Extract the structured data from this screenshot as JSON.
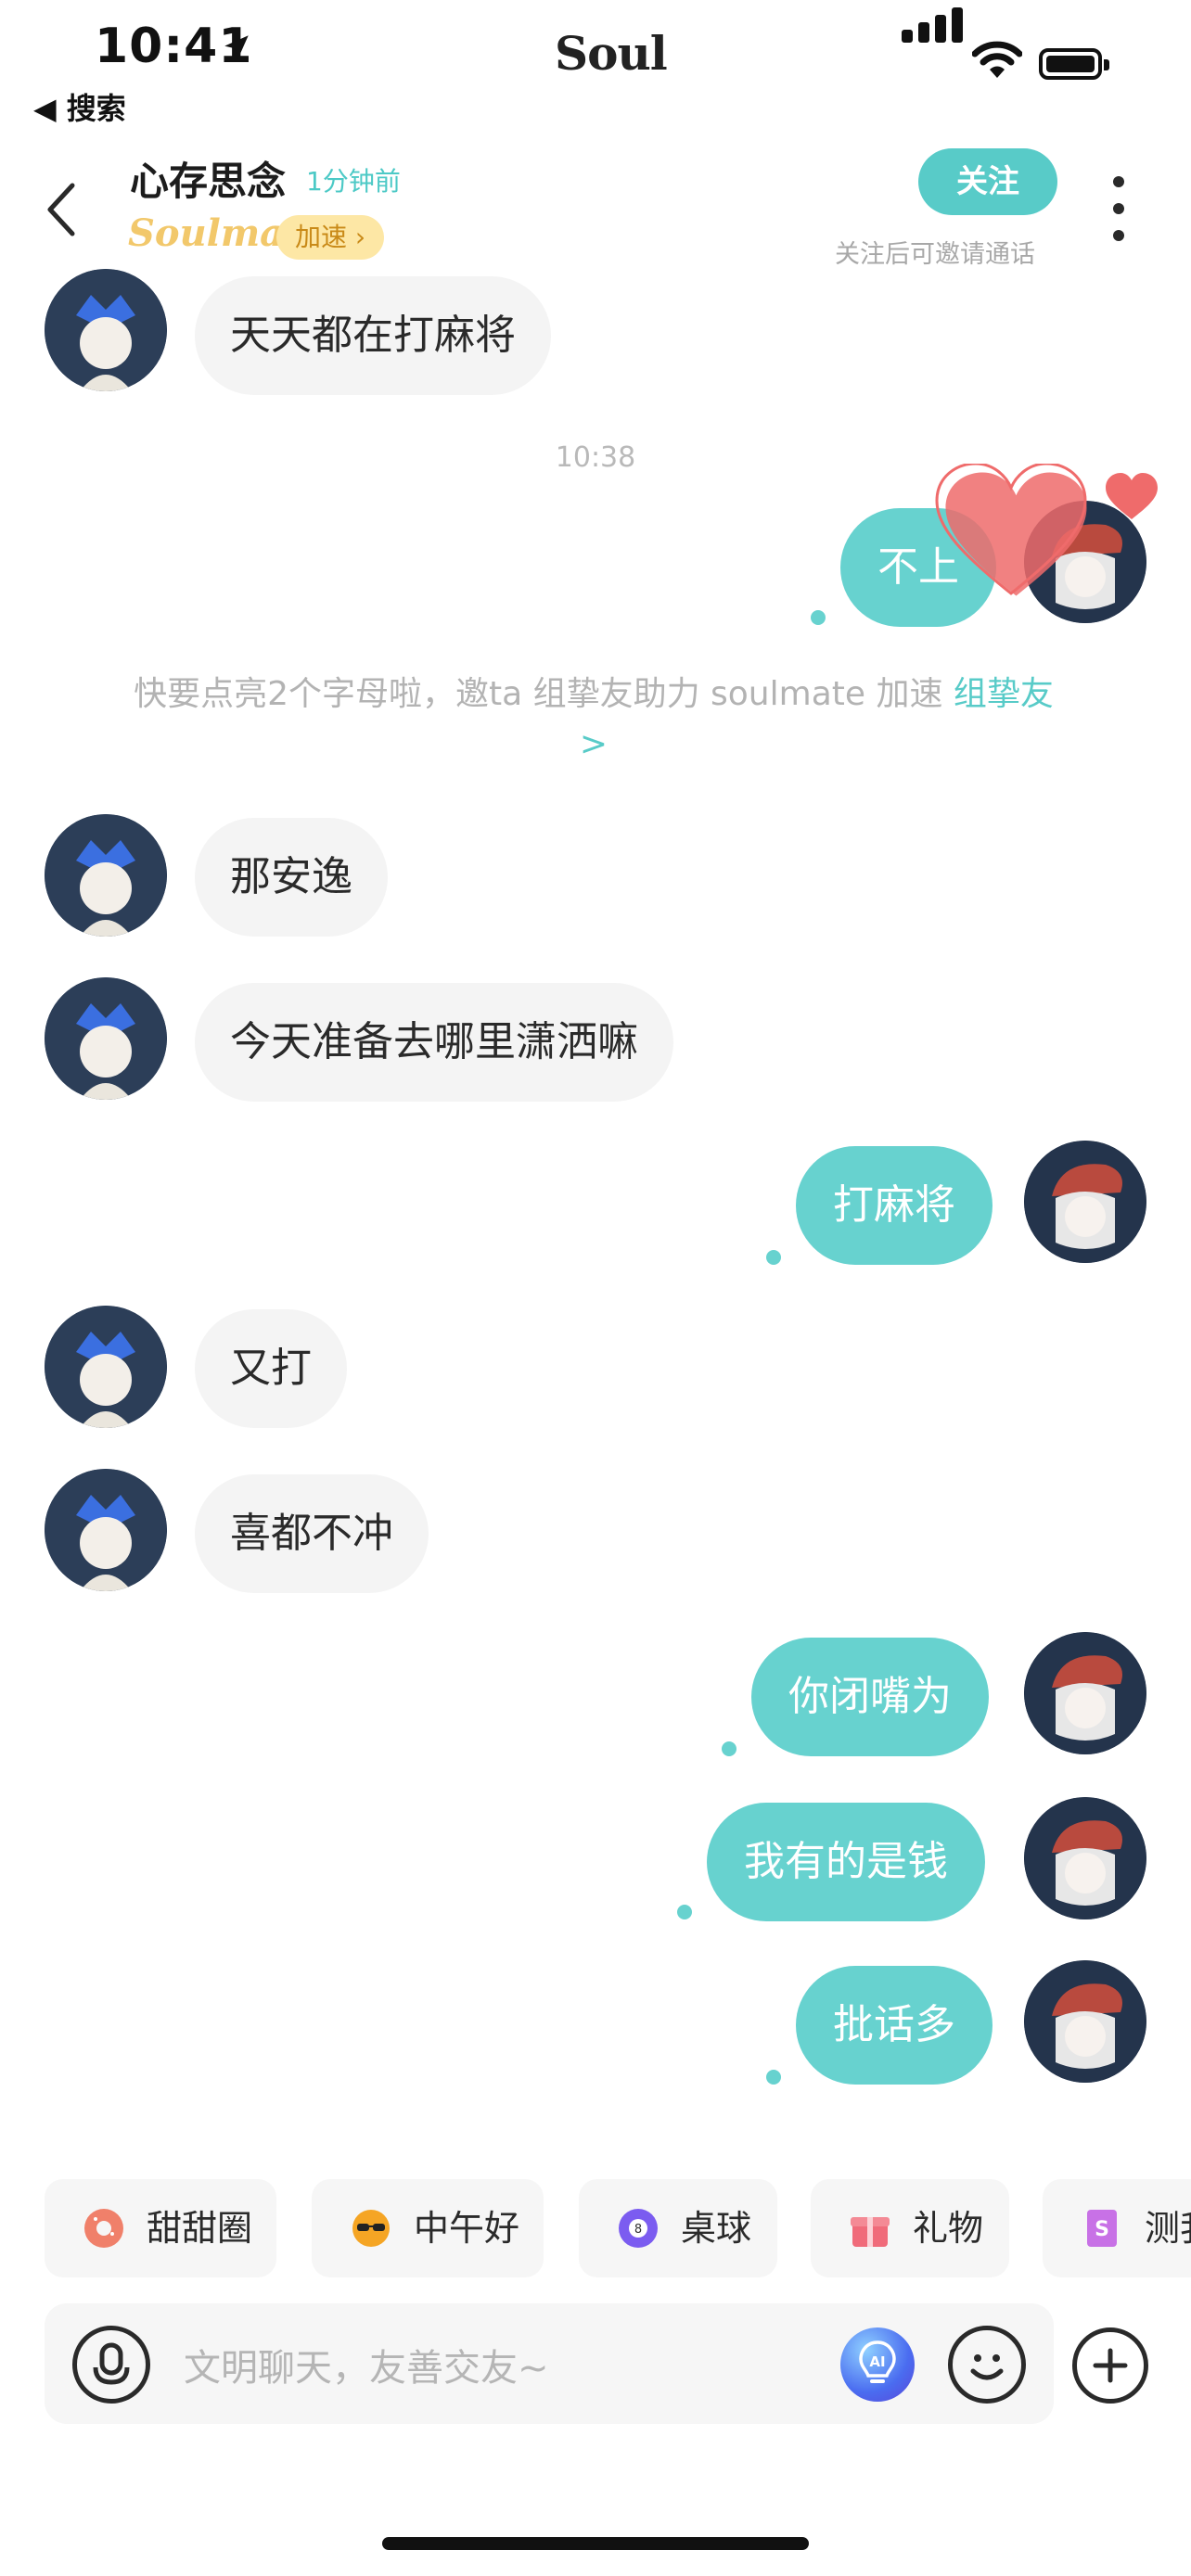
{
  "status_bar": {
    "time": "10:41",
    "back_app": "◀ 搜索",
    "app_logo": "Soul"
  },
  "header": {
    "name": "心存思念",
    "last_active": "1分钟前",
    "soulmate_label": "Soulmate",
    "accelerate": "加速 ›",
    "follow": "关注",
    "follow_hint": "关注后可邀请通话"
  },
  "messages": [
    {
      "side": "in",
      "text": "天天都在打麻将"
    },
    {
      "type": "time",
      "text": "10:38"
    },
    {
      "side": "out",
      "text": "不上"
    },
    {
      "type": "system",
      "text": "快要点亮2个字母啦，邀ta 组挚友助力 soulmate 加速 ",
      "link": "组挚友>"
    },
    {
      "side": "in",
      "text": "那安逸"
    },
    {
      "side": "in",
      "text": "今天准备去哪里潇洒嘛"
    },
    {
      "side": "out",
      "text": "打麻将"
    },
    {
      "side": "in",
      "text": "又打"
    },
    {
      "side": "in",
      "text": "喜都不冲"
    },
    {
      "side": "out",
      "text": "你闭嘴为"
    },
    {
      "side": "out",
      "text": "我有的是钱"
    },
    {
      "side": "out",
      "text": "批话多"
    }
  ],
  "quick_actions": [
    {
      "label": "甜甜圈",
      "icon": "donut-icon"
    },
    {
      "label": "中午好",
      "icon": "sun-sunglasses-icon"
    },
    {
      "label": "桌球",
      "icon": "billiard-ball-icon"
    },
    {
      "label": "礼物",
      "icon": "gift-icon"
    },
    {
      "label": "测我",
      "icon": "book-icon"
    }
  ],
  "input": {
    "placeholder": "文明聊天，友善交友~",
    "ai_label": "AI"
  },
  "colors": {
    "accent": "#58cbc8",
    "bubble_out": "#67d2cf",
    "bubble_in": "#f4f4f4",
    "accelerate_bg": "#fde7a5"
  }
}
